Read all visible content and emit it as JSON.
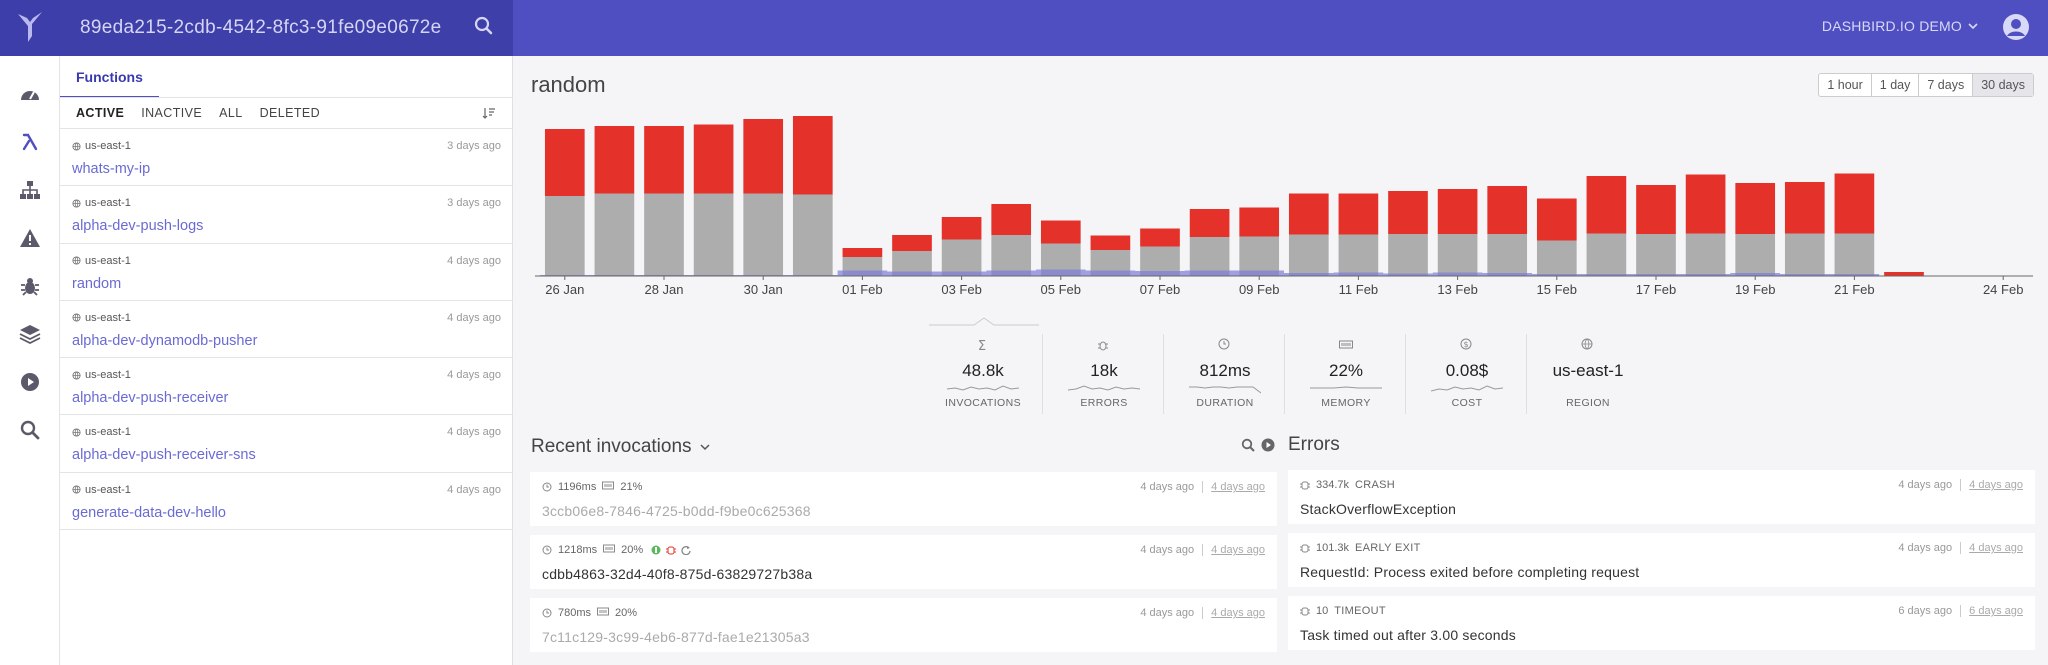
{
  "app": {
    "search_value": "89eda215-2cdb-4542-8fc3-91fe09e0672e",
    "account_label": "DASHBIRD.IO DEMO"
  },
  "nav": [
    "dashboard-icon",
    "lambda-icon",
    "sitemap-icon",
    "alert-icon",
    "bug-icon",
    "layers-icon",
    "play-icon",
    "search-icon"
  ],
  "functions": {
    "tab_label": "Functions",
    "filters": [
      "ACTIVE",
      "INACTIVE",
      "ALL",
      "DELETED"
    ],
    "items": [
      {
        "region": "us-east-1",
        "ago": "3 days ago",
        "name": "whats-my-ip"
      },
      {
        "region": "us-east-1",
        "ago": "3 days ago",
        "name": "alpha-dev-push-logs"
      },
      {
        "region": "us-east-1",
        "ago": "4 days ago",
        "name": "random"
      },
      {
        "region": "us-east-1",
        "ago": "4 days ago",
        "name": "alpha-dev-dynamodb-pusher"
      },
      {
        "region": "us-east-1",
        "ago": "4 days ago",
        "name": "alpha-dev-push-receiver"
      },
      {
        "region": "us-east-1",
        "ago": "4 days ago",
        "name": "alpha-dev-push-receiver-sns"
      },
      {
        "region": "us-east-1",
        "ago": "4 days ago",
        "name": "generate-data-dev-hello"
      }
    ]
  },
  "main": {
    "title": "random",
    "ranges": [
      "1 hour",
      "1 day",
      "7 days",
      "30 days"
    ],
    "selected_range": "30 days"
  },
  "chart_data": {
    "type": "bar",
    "stacked": true,
    "categories": [
      "26 Jan",
      "27 Jan",
      "28 Jan",
      "29 Jan",
      "30 Jan",
      "31 Jan",
      "01 Feb",
      "02 Feb",
      "03 Feb",
      "04 Feb",
      "05 Feb",
      "06 Feb",
      "07 Feb",
      "08 Feb",
      "09 Feb",
      "10 Feb",
      "11 Feb",
      "12 Feb",
      "13 Feb",
      "14 Feb",
      "15 Feb",
      "16 Feb",
      "17 Feb",
      "18 Feb",
      "19 Feb",
      "20 Feb",
      "21 Feb",
      "22 Feb",
      "23 Feb",
      "24 Feb"
    ],
    "tick_labels": [
      "26 Jan",
      "28 Jan",
      "30 Jan",
      "01 Feb",
      "03 Feb",
      "05 Feb",
      "07 Feb",
      "09 Feb",
      "11 Feb",
      "13 Feb",
      "15 Feb",
      "17 Feb",
      "19 Feb",
      "21 Feb",
      "24 Feb"
    ],
    "series": [
      {
        "values": [
          1600,
          1650,
          1650,
          1650,
          1650,
          1630,
          380,
          500,
          730,
          820,
          650,
          520,
          590,
          780,
          790,
          830,
          830,
          840,
          840,
          840,
          710,
          850,
          840,
          850,
          840,
          850,
          850,
          0,
          0,
          0
        ],
        "color": "#adadad"
      },
      {
        "values": [
          1340,
          1350,
          1350,
          1380,
          1490,
          1580,
          180,
          320,
          450,
          620,
          460,
          290,
          360,
          560,
          580,
          820,
          820,
          860,
          900,
          960,
          840,
          1150,
          980,
          1180,
          1020,
          1030,
          1200,
          80,
          0,
          0
        ],
        "color": "#e4322b"
      }
    ],
    "overlay": {
      "values": [
        20,
        20,
        20,
        20,
        20,
        20,
        110,
        90,
        90,
        110,
        130,
        110,
        100,
        110,
        110,
        60,
        70,
        50,
        70,
        60,
        40,
        40,
        40,
        40,
        60,
        40,
        40,
        0,
        0,
        0
      ],
      "color": "#7a7ad8"
    },
    "ylim": [
      0,
      3200
    ],
    "grid": false
  },
  "stats": [
    {
      "icon": "sigma-icon",
      "value": "48.8k",
      "label": "INVOCATIONS"
    },
    {
      "icon": "bug-icon",
      "value": "18k",
      "label": "ERRORS"
    },
    {
      "icon": "clock-icon",
      "value": "812ms",
      "label": "DURATION"
    },
    {
      "icon": "memory-icon",
      "value": "22%",
      "label": "MEMORY"
    },
    {
      "icon": "dollar-icon",
      "value": "0.08$",
      "label": "COST"
    },
    {
      "icon": "globe-icon",
      "value": "us-east-1",
      "label": "REGION"
    }
  ],
  "invocations": {
    "title": "Recent invocations",
    "items": [
      {
        "duration": "1196ms",
        "memory": "21%",
        "ago": "4 days ago",
        "ago2": "4 days ago",
        "id": "3ccb06e8-7846-4725-b0dd-f9be0c625368",
        "dim": true,
        "flags": false
      },
      {
        "duration": "1218ms",
        "memory": "20%",
        "ago": "4 days ago",
        "ago2": "4 days ago",
        "id": "cdbb4863-32d4-40f8-875d-63829727b38a",
        "dim": false,
        "flags": true
      },
      {
        "duration": "780ms",
        "memory": "20%",
        "ago": "4 days ago",
        "ago2": "4 days ago",
        "id": "7c11c129-3c99-4eb6-877d-fae1e21305a3",
        "dim": true,
        "flags": false
      }
    ]
  },
  "errors": {
    "title": "Errors",
    "items": [
      {
        "count": "334.7k",
        "type": "CRASH",
        "ago": "4 days ago",
        "ago2": "4 days ago",
        "message": "StackOverflowException"
      },
      {
        "count": "101.3k",
        "type": "EARLY EXIT",
        "ago": "4 days ago",
        "ago2": "4 days ago",
        "message": "RequestId: Process exited before completing request"
      },
      {
        "count": "10",
        "type": "TIMEOUT",
        "ago": "6 days ago",
        "ago2": "6 days ago",
        "message": "Task timed out after 3.00 seconds"
      }
    ]
  }
}
